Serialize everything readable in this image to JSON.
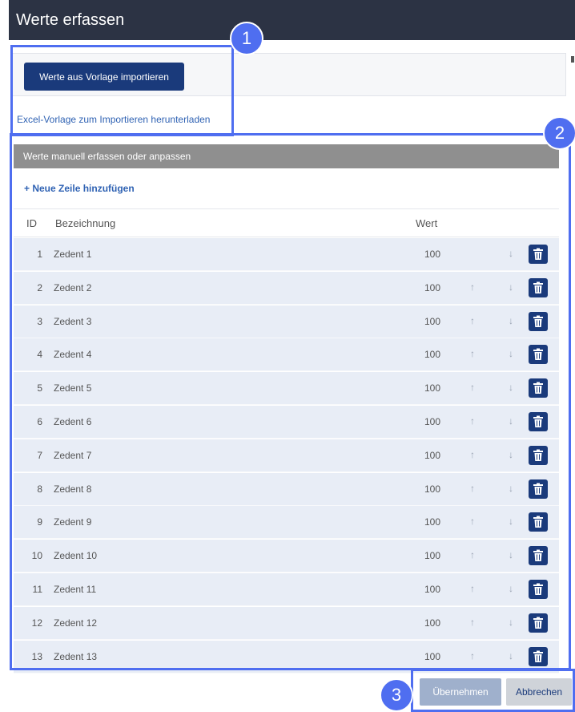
{
  "window": {
    "title": "Werte erfassen"
  },
  "import": {
    "button_label": "Werte aus Vorlage importieren",
    "download_link": "Excel-Vorlage zum Importieren herunterladen"
  },
  "manual": {
    "header": "Werte manuell erfassen oder anpassen",
    "add_row_label": "+ Neue Zeile hinzufügen",
    "columns": {
      "id": "ID",
      "name": "Bezeichnung",
      "value": "Wert"
    },
    "rows": [
      {
        "id": "1",
        "name": "Zedent 1",
        "value": "100",
        "up": false,
        "down": true
      },
      {
        "id": "2",
        "name": "Zedent 2",
        "value": "100",
        "up": true,
        "down": true
      },
      {
        "id": "3",
        "name": "Zedent 3",
        "value": "100",
        "up": true,
        "down": true
      },
      {
        "id": "4",
        "name": "Zedent 4",
        "value": "100",
        "up": true,
        "down": true
      },
      {
        "id": "5",
        "name": "Zedent 5",
        "value": "100",
        "up": true,
        "down": true
      },
      {
        "id": "6",
        "name": "Zedent 6",
        "value": "100",
        "up": true,
        "down": true
      },
      {
        "id": "7",
        "name": "Zedent 7",
        "value": "100",
        "up": true,
        "down": true
      },
      {
        "id": "8",
        "name": "Zedent 8",
        "value": "100",
        "up": true,
        "down": true
      },
      {
        "id": "9",
        "name": "Zedent 9",
        "value": "100",
        "up": true,
        "down": true
      },
      {
        "id": "10",
        "name": "Zedent 10",
        "value": "100",
        "up": true,
        "down": true
      },
      {
        "id": "11",
        "name": "Zedent 11",
        "value": "100",
        "up": true,
        "down": true
      },
      {
        "id": "12",
        "name": "Zedent 12",
        "value": "100",
        "up": true,
        "down": true
      },
      {
        "id": "13",
        "name": "Zedent 13",
        "value": "100",
        "up": true,
        "down": true
      }
    ],
    "up_glyph": "↑",
    "down_glyph": "↓"
  },
  "footer": {
    "apply_label": "Übernehmen",
    "cancel_label": "Abbrechen"
  },
  "callouts": [
    "1",
    "2",
    "3"
  ],
  "colors": {
    "titlebar": "#2c3344",
    "primary": "#1a3a7b",
    "callout": "#4f6ef0",
    "link": "#2f62b3"
  }
}
